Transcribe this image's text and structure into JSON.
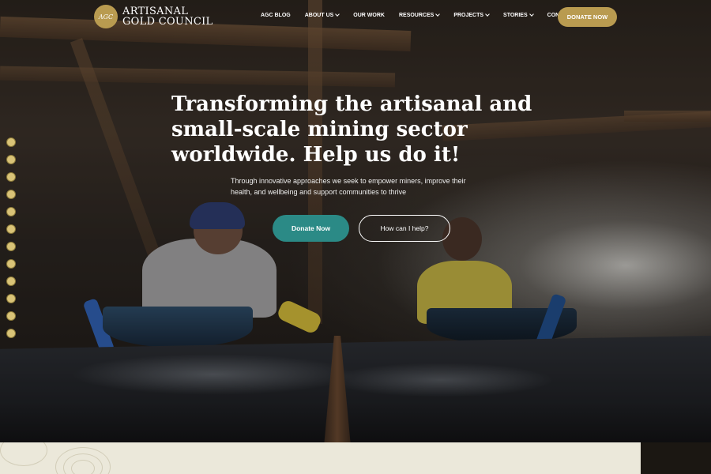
{
  "logo": {
    "badge_text": "AGC",
    "line1": "ARTISANAL",
    "line2": "GOLD COUNCIL"
  },
  "nav": {
    "items": [
      {
        "label": "AGC BLOG",
        "dropdown": false
      },
      {
        "label": "ABOUT US",
        "dropdown": true
      },
      {
        "label": "OUR WORK",
        "dropdown": false
      },
      {
        "label": "RESOURCES",
        "dropdown": true
      },
      {
        "label": "PROJECTS",
        "dropdown": true
      },
      {
        "label": "STORIES",
        "dropdown": true
      },
      {
        "label": "CONTACT US",
        "dropdown": false
      }
    ],
    "donate_label": "DONATE NOW"
  },
  "hero": {
    "title": "Transforming the artisanal and small-scale mining sector worldwide. Help us do it!",
    "subtitle": "Through innovative approaches we seek to empower miners, improve their health, and wellbeing and support communities to thrive",
    "primary_button": "Donate Now",
    "secondary_button": "How can I help?"
  },
  "slider": {
    "dot_count": 12
  },
  "colors": {
    "gold": "#b99b50",
    "teal": "#2b8a86",
    "panel": "#ebe8da"
  }
}
